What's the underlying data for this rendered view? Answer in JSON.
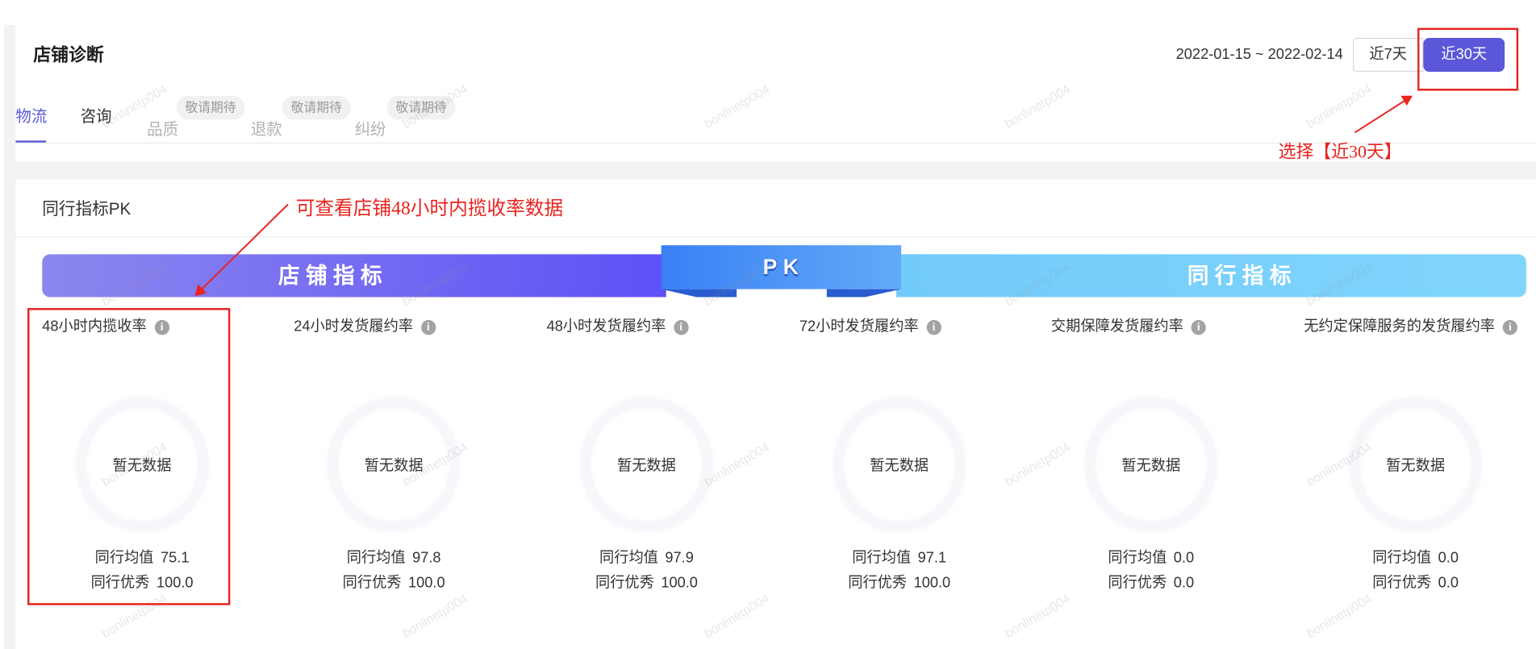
{
  "shop_diagnosis": {
    "title": "店铺诊断",
    "date_range": "2022-01-15 ~ 2022-02-14",
    "range_buttons": [
      {
        "label": "近7天",
        "selected": false
      },
      {
        "label": "近30天",
        "selected": true
      }
    ],
    "tabs": [
      {
        "label": "物流",
        "active": true
      },
      {
        "label": "咨询",
        "active": false
      },
      {
        "label": "品质",
        "badge": "敬请期待",
        "disabled": true
      },
      {
        "label": "退款",
        "badge": "敬请期待",
        "disabled": true
      },
      {
        "label": "纠纷",
        "badge": "敬请期待",
        "disabled": true
      }
    ]
  },
  "peer_pk": {
    "title": "同行指标PK",
    "banner": {
      "shop_label": "店铺指标",
      "pk_label": "PK",
      "peer_label": "同行指标"
    },
    "avg_label": "同行均值",
    "best_label": "同行优秀",
    "metrics": [
      {
        "title": "48小时内揽收率",
        "status": "暂无数据",
        "peer_avg": "75.1",
        "peer_best": "100.0"
      },
      {
        "title": "24小时发货履约率",
        "status": "暂无数据",
        "peer_avg": "97.8",
        "peer_best": "100.0"
      },
      {
        "title": "48小时发货履约率",
        "status": "暂无数据",
        "peer_avg": "97.9",
        "peer_best": "100.0"
      },
      {
        "title": "72小时发货履约率",
        "status": "暂无数据",
        "peer_avg": "97.1",
        "peer_best": "100.0"
      },
      {
        "title": "交期保障发货履约率",
        "status": "暂无数据",
        "peer_avg": "0.0",
        "peer_best": "0.0"
      },
      {
        "title": "无约定保障服务的发货履约率",
        "status": "暂无数据",
        "peer_avg": "0.0",
        "peer_best": "0.0"
      }
    ]
  },
  "annotations": {
    "select_range_note": "选择【近30天】",
    "metric_note": "可查看店铺48小时内揽收率数据"
  },
  "watermark": {
    "text": "bonlinetp004"
  },
  "icons": {
    "metric_info": "info-icon"
  },
  "colors": {
    "accent": "#5b57d8",
    "annotation_red": "#e8231e",
    "page_bg": "#f2f3f5",
    "disabled_text": "#b3b3b3",
    "shop_banner_start": "#8c87ee",
    "shop_banner_end": "#5f50f6",
    "peer_banner_start": "#72cbfb",
    "peer_banner_end": "#80d5fb",
    "pk_start": "#3a80f5",
    "pk_end": "#62aaf8",
    "pk_fold": "#2a5bd0"
  }
}
